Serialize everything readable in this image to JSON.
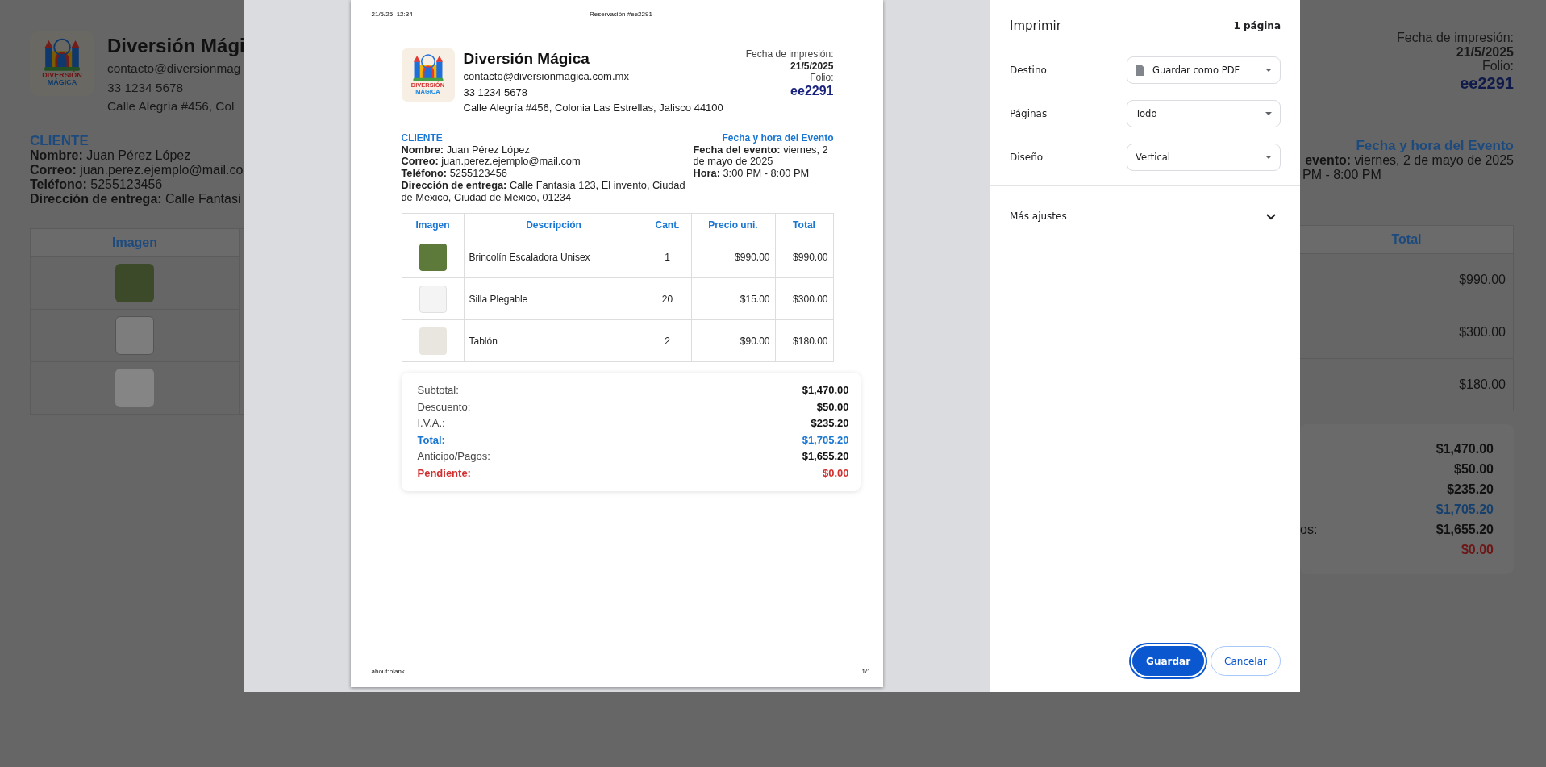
{
  "background_page": {
    "logo": {
      "line_1": "DIVERSIÓN",
      "line_2": "MÁGICA"
    },
    "business_name": "Diversión Mági",
    "contact_lines": [
      "contacto@diversionmag",
      "33 1234 5678",
      "Calle Alegría #456, Col"
    ],
    "client_heading": "CLIENTE",
    "client_lines": [
      "**Nombre:** Juan Pérez López",
      "**Correo:** juan.perez.ejemplo@mail.co",
      "**Teléfono:** 5255123456",
      "**Dirección de entrega:** Calle Fantasi"
    ],
    "print_info": {
      "date_label": "Fecha de impresión:",
      "date": "21/5/2025",
      "folio_label": "Folio:",
      "folio": "ee2291"
    },
    "event_heading": "Fecha y hora del Evento",
    "event_lines": [
      "**evento:** viernes, 2 de mayo de 2025",
      "PM - 8:00 PM"
    ],
    "items_table": {
      "first_column": "Imagen",
      "last_column": "Total",
      "rows": [
        {
          "total": "$990.00"
        },
        {
          "total": "$300.00"
        },
        {
          "total": "$180.00"
        }
      ]
    },
    "totals": [
      {
        "kind": "plain",
        "value": "$1,470.00"
      },
      {
        "kind": "plain",
        "value": "$50.00"
      },
      {
        "kind": "plain",
        "value": "$235.20"
      },
      {
        "kind": "total",
        "value": "$1,705.20"
      },
      {
        "kind": "plain",
        "label": "os:",
        "value": "$1,655.20"
      },
      {
        "kind": "pending",
        "value": "$0.00"
      }
    ]
  },
  "print_dialog": {
    "preview": {
      "header": {
        "left": "21/5/25, 12:34",
        "center": "Reservación #ee2291"
      },
      "logo": {
        "line_1": "DIVERSIÓN",
        "line_2": "MÁGICA"
      },
      "business_name": "Diversión Mágica",
      "contact_lines": [
        "contacto@diversionmagica.com.mx",
        "33 1234 5678",
        "Calle Alegría #456, Colonia Las Estrellas, Jalisco 44100"
      ],
      "print_info": {
        "date_label": "Fecha de impresión:",
        "date": "21/5/2025",
        "folio_label": "Folio:",
        "folio": "ee2291"
      },
      "client_heading": "CLIENTE",
      "client_lines": [
        "**Nombre:** Juan Pérez López",
        "**Correo:** juan.perez.ejemplo@mail.com",
        "**Teléfono:** 5255123456",
        "**Dirección de entrega:** Calle Fantasia 123, El invento, Ciudad de México, Ciudad de México, 01234"
      ],
      "event_heading": "Fecha y hora del Evento",
      "event_lines": [
        "**Fecha del evento:** viernes, 2 de mayo de 2025",
        "**Hora:** 3:00 PM - 8:00 PM"
      ],
      "items_table": {
        "columns": [
          "Imagen",
          "Descripción",
          "Cant.",
          "Precio uni.",
          "Total"
        ],
        "rows": [
          {
            "description": "Brincolín Escaladora Unisex",
            "quantity": "1",
            "unit_price": "$990.00",
            "total": "$990.00"
          },
          {
            "description": "Silla Plegable",
            "quantity": "20",
            "unit_price": "$15.00",
            "total": "$300.00"
          },
          {
            "description": "Tablón",
            "quantity": "2",
            "unit_price": "$90.00",
            "total": "$180.00"
          }
        ]
      },
      "totals": [
        {
          "kind": "plain",
          "label": "Subtotal:",
          "value": "$1,470.00"
        },
        {
          "kind": "plain",
          "label": "Descuento:",
          "value": "$50.00"
        },
        {
          "kind": "plain",
          "label": "I.V.A.:",
          "value": "$235.20"
        },
        {
          "kind": "total",
          "label": "Total:",
          "value": "$1,705.20"
        },
        {
          "kind": "plain",
          "label": "Anticipo/Pagos:",
          "value": "$1,655.20"
        },
        {
          "kind": "pending",
          "label": "Pendiente:",
          "value": "$0.00"
        }
      ],
      "footer": {
        "left": "about:blank",
        "right": "1/1"
      }
    },
    "settings": {
      "title": "Imprimir",
      "page_count": "1 página",
      "fields": [
        {
          "kind": "destination",
          "label": "Destino",
          "value": "Guardar como PDF"
        },
        {
          "kind": "plain",
          "label": "Páginas",
          "value": "Todo"
        },
        {
          "kind": "plain",
          "label": "Diseño",
          "value": "Vertical"
        }
      ],
      "more_settings": {
        "label": "Más ajustes",
        "expanded": false
      },
      "buttons": [
        {
          "kind": "primary",
          "label": "Guardar",
          "focused": true
        },
        {
          "kind": "secondary",
          "label": "Cancelar",
          "focused": false
        }
      ]
    }
  }
}
